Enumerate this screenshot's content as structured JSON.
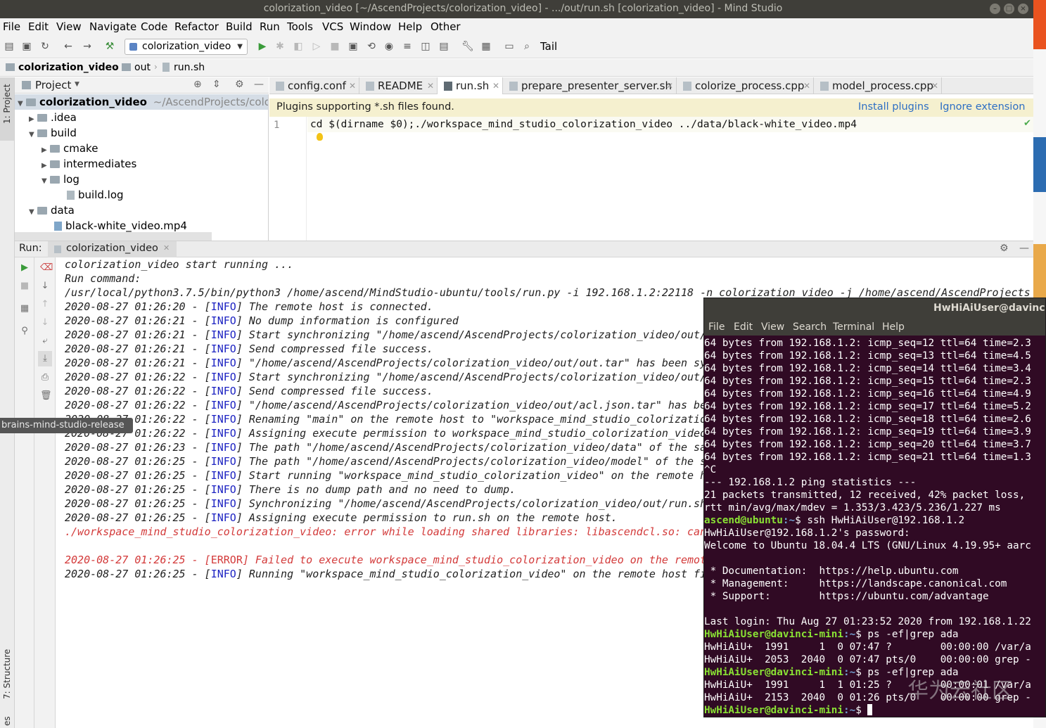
{
  "window": {
    "title": "colorization_video [~/AscendProjects/colorization_video] - .../out/run.sh [colorization_video] - Mind Studio"
  },
  "menu": [
    "File",
    "Edit",
    "View",
    "Navigate",
    "Code",
    "Refactor",
    "Build",
    "Run",
    "Tools",
    "VCS",
    "Window",
    "Help",
    "Other"
  ],
  "toolbar": {
    "run_config": "colorization_video",
    "tail_label": "Tail"
  },
  "breadcrumb": [
    "colorization_video",
    "out",
    "run.sh"
  ],
  "left_stripe": {
    "project_label": "1: Project",
    "structure_label": "7: Structure",
    "favorites_label": "es"
  },
  "project_pane": {
    "title": "Project",
    "root_name": "colorization_video",
    "root_path": "~/AscendProjects/colorizat",
    "nodes": [
      ".idea",
      "build",
      "cmake",
      "intermediates",
      "log",
      "build.log",
      "data",
      "black-white_video.mp4"
    ]
  },
  "editor": {
    "tabs": [
      "config.conf",
      "README",
      "run.sh",
      "prepare_presenter_server.sh",
      "colorize_process.cpp",
      "model_process.cpp"
    ],
    "active_tab": "run.sh",
    "banner_text": "Plugins supporting *.sh files found.",
    "banner_install": "Install plugins",
    "banner_ignore": "Ignore extension",
    "line_number": "1",
    "code_line": "cd $(dirname $0);./workspace_mind_studio_colorization_video ../data/black-white_video.mp4"
  },
  "run_panel": {
    "label": "Run:",
    "tab": "colorization_video",
    "lines": [
      {
        "pre": "colorization_video start running ...",
        "tag": "",
        "post": "",
        "type": "plain"
      },
      {
        "pre": "Run command:",
        "tag": "",
        "post": "",
        "type": "plain"
      },
      {
        "pre": "/usr/local/python3.7.5/bin/python3 /home/ascend/MindStudio-ubuntu/tools/run.py -i 192.168.1.2:22118 -n colorization_video -j /home/ascend/AscendProjects",
        "tag": "",
        "post": "",
        "type": "plain"
      },
      {
        "pre": "2020-08-27 01:26:20 - [",
        "tag": "INFO",
        "post": "] The remote host is connected.",
        "type": "info"
      },
      {
        "pre": "2020-08-27 01:26:21 - [",
        "tag": "INFO",
        "post": "] No dump information is configured",
        "type": "info"
      },
      {
        "pre": "2020-08-27 01:26:21 - [",
        "tag": "INFO",
        "post": "] Start synchronizing \"/home/ascend/AscendProjects/colorization_video/out/",
        "type": "info"
      },
      {
        "pre": "2020-08-27 01:26:21 - [",
        "tag": "INFO",
        "post": "] Send compressed file success.",
        "type": "info"
      },
      {
        "pre": "2020-08-27 01:26:21 - [",
        "tag": "INFO",
        "post": "] \"/home/ascend/AscendProjects/colorization_video/out/out.tar\" has been sy",
        "type": "info"
      },
      {
        "pre": "2020-08-27 01:26:22 - [",
        "tag": "INFO",
        "post": "] Start synchronizing \"/home/ascend/AscendProjects/colorization_video/out/",
        "type": "info"
      },
      {
        "pre": "2020-08-27 01:26:22 - [",
        "tag": "INFO",
        "post": "] Send compressed file success.",
        "type": "info"
      },
      {
        "pre": "2020-08-27 01:26:22 - [",
        "tag": "INFO",
        "post": "] \"/home/ascend/AscendProjects/colorization_video/out/acl.json.tar\" has be",
        "type": "info"
      },
      {
        "pre": "2020-08-27 01:26:22 - [",
        "tag": "INFO",
        "post": "] Renaming \"main\" on the remote host to \"workspace_mind_studio_colorizatio",
        "type": "info"
      },
      {
        "pre": "2020-08-27 01:26:22 - [",
        "tag": "INFO",
        "post": "] Assigning execute permission to workspace_mind_studio_colorization_video",
        "type": "info"
      },
      {
        "pre": "2020-08-27 01:26:23 - [",
        "tag": "INFO",
        "post": "] The path \"/home/ascend/AscendProjects/colorization_video/data\" of the sa",
        "type": "info"
      },
      {
        "pre": "2020-08-27 01:26:25 - [",
        "tag": "INFO",
        "post": "] The path \"/home/ascend/AscendProjects/colorization_video/model\" of the s",
        "type": "info"
      },
      {
        "pre": "2020-08-27 01:26:25 - [",
        "tag": "INFO",
        "post": "] Start running \"workspace_mind_studio_colorization_video\" on the remote h",
        "type": "info"
      },
      {
        "pre": "2020-08-27 01:26:25 - [",
        "tag": "INFO",
        "post": "] There is no dump path and no need to dump.",
        "type": "info"
      },
      {
        "pre": "2020-08-27 01:26:25 - [",
        "tag": "INFO",
        "post": "] Synchronizing \"/home/ascend/AscendProjects/colorization_video/out/run.sh",
        "type": "info"
      },
      {
        "pre": "2020-08-27 01:26:25 - [",
        "tag": "INFO",
        "post": "] Assigning execute permission to run.sh on the remote host.",
        "type": "info"
      },
      {
        "pre": "./workspace_mind_studio_colorization_video: error while loading shared libraries: libascendcl.so: can",
        "tag": "",
        "post": "",
        "type": "error"
      },
      {
        "pre": "",
        "tag": "",
        "post": "",
        "type": "plain"
      },
      {
        "pre": "2020-08-27 01:26:25 - [",
        "tag": "ERROR",
        "post": "] Failed to execute workspace_mind_studio_colorization_video on the remot",
        "type": "error"
      },
      {
        "pre": "2020-08-27 01:26:25 - [",
        "tag": "INFO",
        "post": "] Running \"workspace_mind_studio_colorization_video\" on the remote host fi",
        "type": "info"
      }
    ]
  },
  "tooltip": "brains-mind-studio-release",
  "terminal": {
    "title": "HwHiAiUser@davinci-m",
    "menu": [
      "File",
      "Edit",
      "View",
      "Search",
      "Terminal",
      "Help"
    ],
    "lines": [
      {
        "p": "",
        "h": "",
        "t": "64 bytes from 192.168.1.2: icmp_seq=12 ttl=64 time=2.3"
      },
      {
        "p": "",
        "h": "",
        "t": "64 bytes from 192.168.1.2: icmp_seq=13 ttl=64 time=4.5"
      },
      {
        "p": "",
        "h": "",
        "t": "64 bytes from 192.168.1.2: icmp_seq=14 ttl=64 time=3.4"
      },
      {
        "p": "",
        "h": "",
        "t": "64 bytes from 192.168.1.2: icmp_seq=15 ttl=64 time=2.3"
      },
      {
        "p": "",
        "h": "",
        "t": "64 bytes from 192.168.1.2: icmp_seq=16 ttl=64 time=4.9"
      },
      {
        "p": "",
        "h": "",
        "t": "64 bytes from 192.168.1.2: icmp_seq=17 ttl=64 time=5.2"
      },
      {
        "p": "",
        "h": "",
        "t": "64 bytes from 192.168.1.2: icmp_seq=18 ttl=64 time=2.6"
      },
      {
        "p": "",
        "h": "",
        "t": "64 bytes from 192.168.1.2: icmp_seq=19 ttl=64 time=3.9"
      },
      {
        "p": "",
        "h": "",
        "t": "64 bytes from 192.168.1.2: icmp_seq=20 ttl=64 time=3.7"
      },
      {
        "p": "",
        "h": "",
        "t": "64 bytes from 192.168.1.2: icmp_seq=21 ttl=64 time=1.3"
      },
      {
        "p": "",
        "h": "",
        "t": "^C"
      },
      {
        "p": "",
        "h": "",
        "t": "--- 192.168.1.2 ping statistics ---"
      },
      {
        "p": "",
        "h": "",
        "t": "21 packets transmitted, 12 received, 42% packet loss,"
      },
      {
        "p": "",
        "h": "",
        "t": "rtt min/avg/max/mdev = 1.353/3.423/5.236/1.227 ms"
      },
      {
        "p": "ascend@ubuntu",
        "h": ":~",
        "t": "$ ssh HwHiAiUser@192.168.1.2"
      },
      {
        "p": "",
        "h": "",
        "t": "HwHiAiUser@192.168.1.2's password:"
      },
      {
        "p": "",
        "h": "",
        "t": "Welcome to Ubuntu 18.04.4 LTS (GNU/Linux 4.19.95+ aarc"
      },
      {
        "p": "",
        "h": "",
        "t": ""
      },
      {
        "p": "",
        "h": "",
        "t": " * Documentation:  https://help.ubuntu.com"
      },
      {
        "p": "",
        "h": "",
        "t": " * Management:     https://landscape.canonical.com"
      },
      {
        "p": "",
        "h": "",
        "t": " * Support:        https://ubuntu.com/advantage"
      },
      {
        "p": "",
        "h": "",
        "t": ""
      },
      {
        "p": "",
        "h": "",
        "t": "Last login: Thu Aug 27 01:23:52 2020 from 192.168.1.22"
      },
      {
        "p": "HwHiAiUser@davinci-mini",
        "h": ":~",
        "t": "$ ps -ef|grep ada"
      },
      {
        "p": "",
        "h": "",
        "t": "HwHiAiU+  1991     1  0 07:47 ?        00:00:00 /var/a"
      },
      {
        "p": "",
        "h": "",
        "t": "HwHiAiU+  2053  2040  0 07:47 pts/0    00:00:00 grep -"
      },
      {
        "p": "HwHiAiUser@davinci-mini",
        "h": ":~",
        "t": "$ ps -ef|grep ada"
      },
      {
        "p": "",
        "h": "",
        "t": "HwHiAiU+  1991     1  1 01:25 ?        00:00:01 /var/a"
      },
      {
        "p": "",
        "h": "",
        "t": "HwHiAiU+  2153  2040  0 01:26 pts/0    00:00:00 grep -"
      },
      {
        "p": "HwHiAiUser@davinci-mini",
        "h": ":~",
        "t": "$ "
      }
    ]
  },
  "watermark": "华为云社区",
  "colors": {
    "info_tag": "#1d23c2",
    "error": "#d33a3a",
    "terminal_bg": "#300a24",
    "prompt_green": "#8ae234",
    "prompt_blue": "#729fcf"
  }
}
